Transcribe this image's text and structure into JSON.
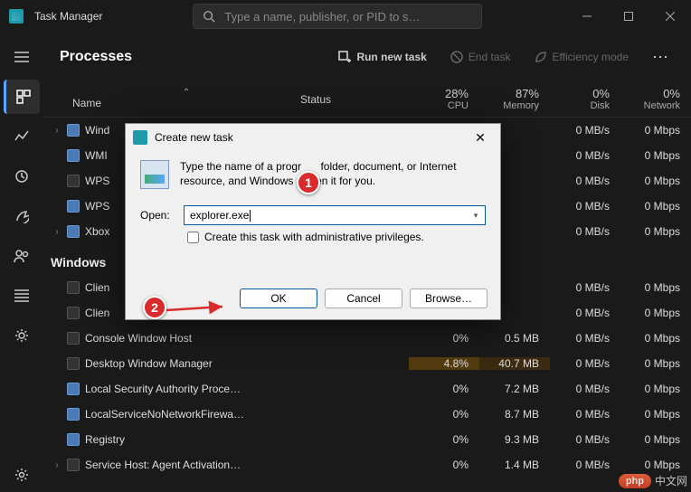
{
  "window": {
    "title": "Task Manager",
    "search_placeholder": "Type a name, publisher, or PID to s…"
  },
  "page": {
    "title": "Processes"
  },
  "toolbar": {
    "run_new_task": "Run new task",
    "end_task": "End task",
    "efficiency_mode": "Efficiency mode"
  },
  "columns": {
    "name": "Name",
    "status": "Status",
    "cpu": {
      "value": "28%",
      "label": "CPU"
    },
    "memory": {
      "value": "87%",
      "label": "Memory"
    },
    "disk": {
      "value": "0%",
      "label": "Disk"
    },
    "network": {
      "value": "0%",
      "label": "Network"
    }
  },
  "groups": [
    {
      "title": "",
      "rows": [
        {
          "exp": true,
          "name": "Wind",
          "disk": "0 MB/s",
          "net": "0 Mbps"
        },
        {
          "exp": false,
          "name": "WMI",
          "disk": "0 MB/s",
          "net": "0 Mbps"
        },
        {
          "exp": false,
          "name": "WPS",
          "disk": "0 MB/s",
          "net": "0 Mbps"
        },
        {
          "exp": false,
          "name": "WPS",
          "disk": "0 MB/s",
          "net": "0 Mbps"
        },
        {
          "exp": true,
          "name": "Xbox",
          "disk": "0 MB/s",
          "net": "0 Mbps"
        }
      ]
    },
    {
      "title": "Windows",
      "rows": [
        {
          "exp": false,
          "name": "Clien",
          "disk": "0 MB/s",
          "net": "0 Mbps"
        },
        {
          "exp": false,
          "name": "Clien",
          "disk": "0 MB/s",
          "net": "0 Mbps"
        },
        {
          "exp": false,
          "name": "Console Window Host",
          "cpu": "0%",
          "mem": "0.5 MB",
          "disk": "0 MB/s",
          "net": "0 Mbps"
        },
        {
          "exp": false,
          "name": "Desktop Window Manager",
          "cpu": "4.8%",
          "mem": "40.7 MB",
          "disk": "0 MB/s",
          "net": "0 Mbps",
          "hi": true
        },
        {
          "exp": false,
          "name": "Local Security Authority Proce…",
          "cpu": "0%",
          "mem": "7.2 MB",
          "disk": "0 MB/s",
          "net": "0 Mbps"
        },
        {
          "exp": false,
          "name": "LocalServiceNoNetworkFirewa…",
          "cpu": "0%",
          "mem": "8.7 MB",
          "disk": "0 MB/s",
          "net": "0 Mbps"
        },
        {
          "exp": false,
          "name": "Registry",
          "cpu": "0%",
          "mem": "9.3 MB",
          "disk": "0 MB/s",
          "net": "0 Mbps"
        },
        {
          "exp": true,
          "name": "Service Host: Agent Activation…",
          "cpu": "0%",
          "mem": "1.4 MB",
          "disk": "0 MB/s",
          "net": "0 Mbps"
        }
      ]
    }
  ],
  "dialog": {
    "title": "Create new task",
    "description_a": "Type the name of a progr",
    "description_b": "folder, document, or Internet resource, and Windows",
    "description_c": "en it for you.",
    "open_label": "Open:",
    "input_value": "explorer.exe",
    "admin_label": "Create this task with administrative privileges.",
    "ok": "OK",
    "cancel": "Cancel",
    "browse": "Browse…"
  },
  "callouts": {
    "c1": "1",
    "c2": "2"
  },
  "watermark": {
    "badge": "php",
    "text": "中文网"
  }
}
